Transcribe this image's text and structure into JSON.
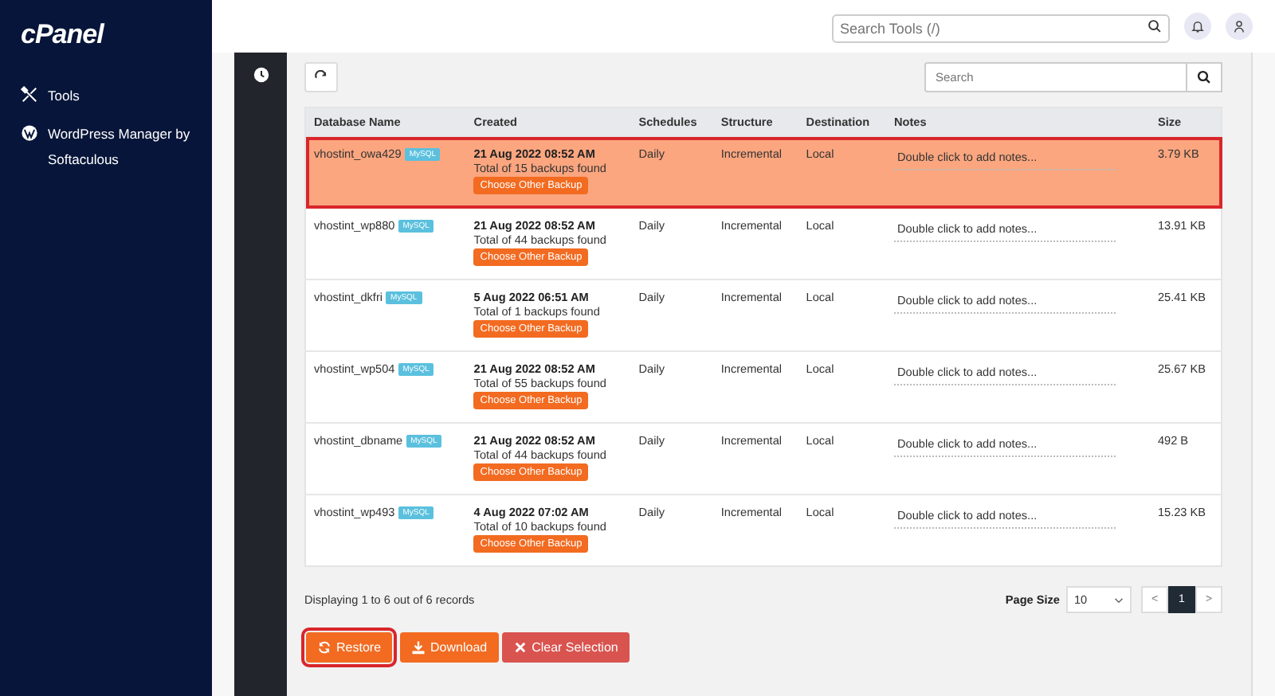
{
  "sidebar": {
    "logo": "cPanel",
    "items": [
      {
        "label": "Tools"
      },
      {
        "label": "WordPress Manager by Softaculous"
      }
    ]
  },
  "topbar": {
    "search_placeholder": "Search Tools (/)"
  },
  "search": {
    "placeholder": "Search"
  },
  "table": {
    "columns": [
      "Database Name",
      "Created",
      "Schedules",
      "Structure",
      "Destination",
      "Notes",
      "Size"
    ],
    "rows": [
      {
        "name": "vhostint_owa429",
        "badge": "MySQL",
        "created": "21 Aug 2022 08:52 AM",
        "total": "Total of 15 backups found",
        "action": "Choose Other Backup",
        "schedule": "Daily",
        "structure": "Incremental",
        "destination": "Local",
        "notes_placeholder": "Double click to add notes...",
        "size": "3.79 KB",
        "selected": true
      },
      {
        "name": "vhostint_wp880",
        "badge": "MySQL",
        "created": "21 Aug 2022 08:52 AM",
        "total": "Total of 44 backups found",
        "action": "Choose Other Backup",
        "schedule": "Daily",
        "structure": "Incremental",
        "destination": "Local",
        "notes_placeholder": "Double click to add notes...",
        "size": "13.91 KB",
        "selected": false
      },
      {
        "name": "vhostint_dkfri",
        "badge": "MySQL",
        "created": "5 Aug 2022 06:51 AM",
        "total": "Total of 1 backups found",
        "action": "Choose Other Backup",
        "schedule": "Daily",
        "structure": "Incremental",
        "destination": "Local",
        "notes_placeholder": "Double click to add notes...",
        "size": "25.41 KB",
        "selected": false
      },
      {
        "name": "vhostint_wp504",
        "badge": "MySQL",
        "created": "21 Aug 2022 08:52 AM",
        "total": "Total of 55 backups found",
        "action": "Choose Other Backup",
        "schedule": "Daily",
        "structure": "Incremental",
        "destination": "Local",
        "notes_placeholder": "Double click to add notes...",
        "size": "25.67 KB",
        "selected": false
      },
      {
        "name": "vhostint_dbname",
        "badge": "MySQL",
        "created": "21 Aug 2022 08:52 AM",
        "total": "Total of 44 backups found",
        "action": "Choose Other Backup",
        "schedule": "Daily",
        "structure": "Incremental",
        "destination": "Local",
        "notes_placeholder": "Double click to add notes...",
        "size": "492 B",
        "selected": false
      },
      {
        "name": "vhostint_wp493",
        "badge": "MySQL",
        "created": "4 Aug 2022 07:02 AM",
        "total": "Total of 10 backups found",
        "action": "Choose Other Backup",
        "schedule": "Daily",
        "structure": "Incremental",
        "destination": "Local",
        "notes_placeholder": "Double click to add notes...",
        "size": "15.23 KB",
        "selected": false
      }
    ]
  },
  "footer": {
    "summary": "Displaying 1 to 6 out of 6 records",
    "page_size_label": "Page Size",
    "page_size": "10",
    "prev": "<",
    "pages": [
      {
        "label": "1",
        "selected": true
      }
    ],
    "next": ">"
  },
  "actions": [
    {
      "label": "Restore",
      "kind": "restore",
      "highlighted": true
    },
    {
      "label": "Download",
      "kind": "download",
      "highlighted": false
    },
    {
      "label": "Clear Selection",
      "kind": "clear",
      "highlighted": false
    }
  ]
}
